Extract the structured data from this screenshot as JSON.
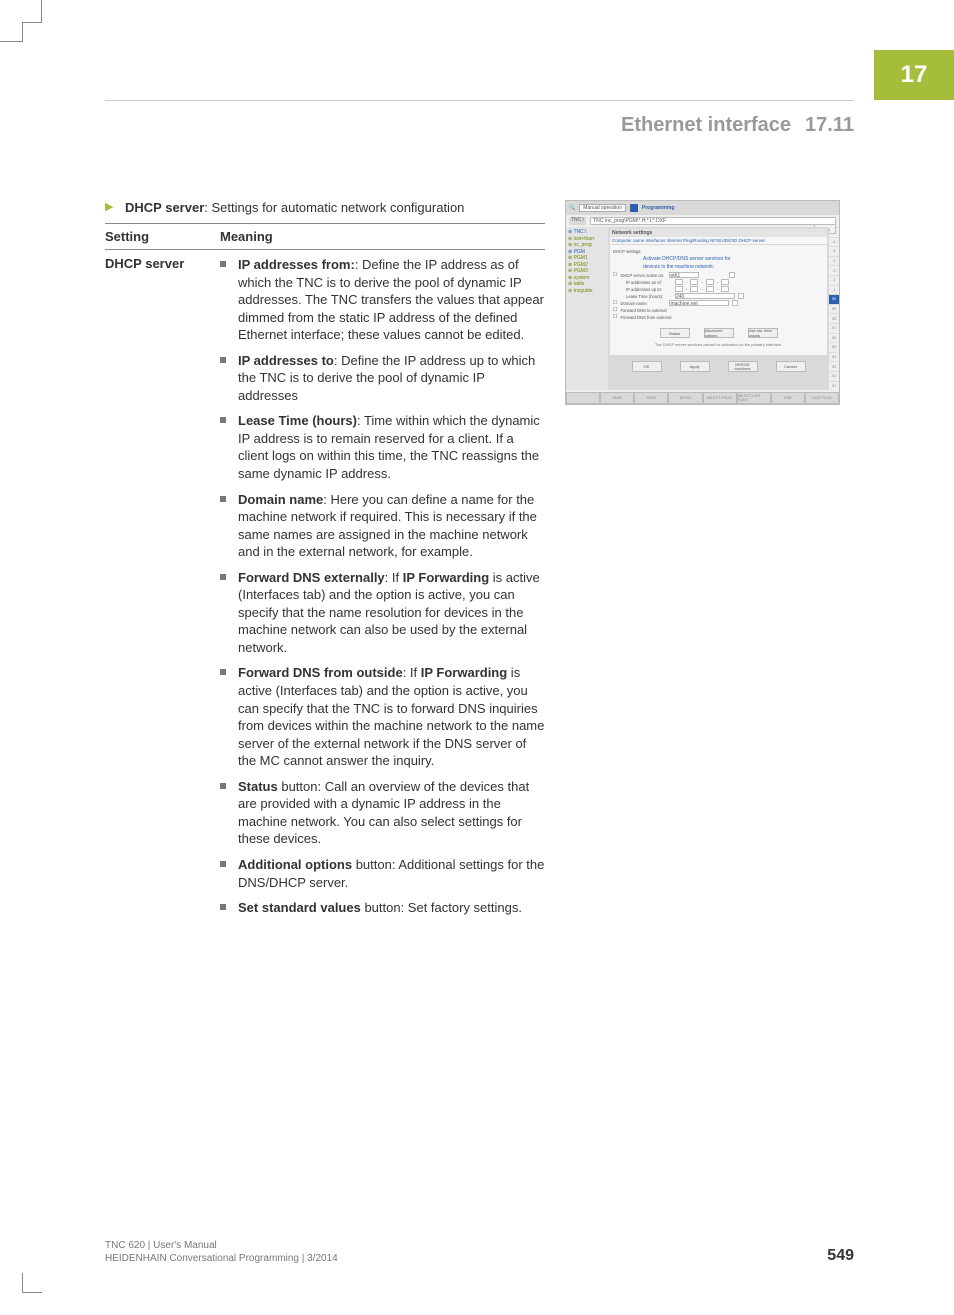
{
  "chapter_tab": "17",
  "header": {
    "title": "Ethernet interface",
    "section": "17.11"
  },
  "intro": {
    "bold": "DHCP server",
    "rest": ": Settings for automatic network configuration"
  },
  "table": {
    "hdr_setting": "Setting",
    "hdr_meaning": "Meaning",
    "setting_label": "DHCP server",
    "items": [
      {
        "bold": "IP addresses from:",
        "rest": ": Define the IP address as of which the TNC is to derive the pool of dynamic IP addresses. The TNC transfers the values that appear dimmed from the static IP address of the defined Ethernet interface; these values cannot be edited."
      },
      {
        "bold": "IP addresses to",
        "rest": ": Define the IP address up to which the TNC is to derive the pool of dynamic IP addresses"
      },
      {
        "bold": "Lease Time (hours)",
        "rest": ": Time within which the dynamic IP address is to remain reserved for a client. If a client logs on within this time, the TNC reassigns the same dynamic IP address."
      },
      {
        "bold": "Domain name",
        "rest": ": Here you can define a name for the machine network if required. This is necessary if the same names are assigned in the machine network and in the external network, for example."
      },
      {
        "bold": "Forward DNS externally",
        "bold2": "IP Forwarding",
        "rest_pre": ": If ",
        "rest_post": " is active (Interfaces tab) and the option is active, you can specify that the name resolution for devices in the machine network can also be used by the external network."
      },
      {
        "bold": "Forward DNS from outside",
        "bold2": "IP Forwarding",
        "rest_pre": ": If ",
        "rest_post": " is active (Interfaces tab) and the option is active, you can specify that the TNC is to forward DNS inquiries from devices within the machine network to the name server of the external network if the DNS server of the MC cannot answer the inquiry."
      },
      {
        "bold": "Status",
        "rest": " button: Call an overview of the devices that are provided with a dynamic IP address in the machine network. You can also select settings for these devices."
      },
      {
        "bold": "Additional options",
        "rest": " button: Additional settings for the DNS/DHCP server."
      },
      {
        "bold": "Set standard values",
        "rest": " button: Set factory settings."
      }
    ]
  },
  "screenshot": {
    "mode_a": "Manual operation",
    "mode_b": "Programming",
    "right_btn": "08:45",
    "path_lbl": "TNC:\\",
    "path_val": "TNC:\\nc_prog\\PGM\\*.H;*.I;*.DXF",
    "win_title": "Network settings",
    "tabs": "Computer name  Interfaces  Internet  Ping/Routing  NFS/UID/GID  DHCP server",
    "sub1": "Activate DHCP/DNS server services for",
    "sub2": "devices in the machine network:",
    "tree": [
      "⊕ TNC:\\",
      "  ⊕ lost+foun",
      "  ⊕ nc_prog",
      "    ⊕ PGM",
      "    ⊕ PGM1",
      "    ⊕ PGM2",
      "    ⊕ PGM3",
      "  ⊕ system",
      "  ⊕ table",
      "  ⊕ tncguide"
    ],
    "form_rows": [
      {
        "label": "DHCP server active on:",
        "field": "eth1"
      },
      {
        "label": "IP addresses as of:"
      },
      {
        "label": "IP addresses up to:"
      },
      {
        "label": "Lease Time (hours):",
        "field": "240"
      },
      {
        "label": "Domain name:",
        "field": "machine.net"
      },
      {
        "label": "Forward DNS to external"
      },
      {
        "label": "Forward DNS from external"
      }
    ],
    "mid_btns": [
      "Status",
      "Advanced options",
      "Use std. field values"
    ],
    "note": "The DHCP server services cannot be activated on the primary interface.",
    "bottom_btns": [
      "OK",
      "Apply",
      "HEROS functions",
      "Cancel"
    ],
    "side_cells": [
      ".7",
      ".6",
      ".5",
      ".4",
      ".3",
      ".2",
      ".1",
      "S0",
      "S9",
      "S8",
      "S7",
      "S6",
      "S5",
      "S4",
      "S3",
      "S2",
      "S1"
    ],
    "side_selected_index": 7,
    "footer_cells": [
      "",
      "PAGE",
      "PAGE",
      "BEGIN",
      "SELECT\nPROG.",
      "SELECT\nLAST FILES",
      "END",
      "LAST\nFILES"
    ]
  },
  "footer": {
    "line1": "TNC 620 | User's Manual",
    "line2": "HEIDENHAIN Conversational Programming | 3/2014",
    "page": "549"
  }
}
